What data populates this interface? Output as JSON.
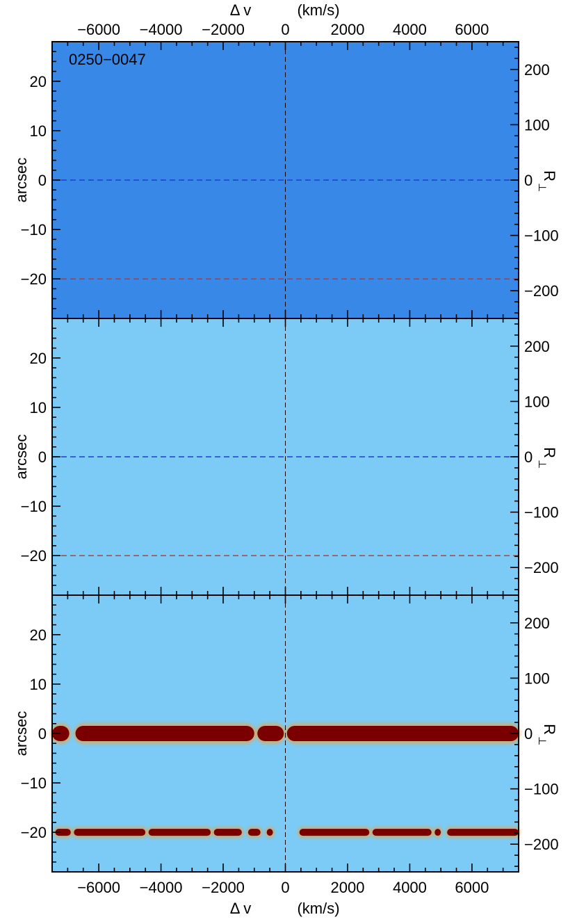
{
  "chart_data": {
    "type": "heatmap",
    "shared": {
      "xlim": [
        -7500,
        7500
      ],
      "ylim": [
        -28,
        28
      ],
      "right_ylim": [
        -250,
        250
      ],
      "x_ticks": [
        -6000,
        -4000,
        -2000,
        0,
        2000,
        4000,
        6000
      ],
      "x_tick_labels": [
        "−6000",
        "−4000",
        "−2000",
        "0",
        "2000",
        "4000",
        "6000"
      ],
      "y_ticks": [
        20,
        10,
        0,
        -10,
        -20
      ],
      "y_tick_labels": [
        "20",
        "10",
        "0",
        "−10",
        "−20"
      ],
      "right_ticks": [
        200,
        100,
        0,
        -100,
        -200
      ],
      "right_tick_labels": [
        "200",
        "100",
        "0",
        "−100",
        "−200"
      ],
      "top_xlabel_main": "Δ v",
      "top_xlabel_unit": "(km/s)",
      "bottom_xlabel_main": "Δ v",
      "bottom_xlabel_unit": "(km/s)",
      "ylabel": "arcsec",
      "right_ylabel_main": "R",
      "right_ylabel_sub": "⊥",
      "colormap": [
        "#0a3fcf",
        "#2a8cf0",
        "#5fd2ee",
        "#aee9c2",
        "#e8f45a",
        "#ffb51e",
        "#f0481a",
        "#7a0000"
      ],
      "vertical_marker_x": 0,
      "blue_dash_y": 0,
      "red_dash_y": -20
    },
    "panels": [
      {
        "label": "0250−0047",
        "texture": "smooth",
        "guide_lines": [
          "blue",
          "red"
        ]
      },
      {
        "label": "",
        "texture": "pixel-noise",
        "guide_lines": [
          "blue",
          "red"
        ]
      },
      {
        "label": "",
        "texture": "pixel-noise-with-bands",
        "guide_lines": [],
        "bands": [
          {
            "y": 0,
            "segments": [
              [
                -7500,
                -6950
              ],
              [
                -6750,
                -1000
              ],
              [
                -900,
                -50
              ],
              [
                50,
                7500
              ]
            ]
          },
          {
            "y": -20,
            "segments": [
              [
                -7400,
                -6900
              ],
              [
                -6800,
                -4500
              ],
              [
                -4400,
                -2400
              ],
              [
                -2300,
                -1400
              ],
              [
                -1200,
                -800
              ],
              [
                -600,
                -400
              ],
              [
                450,
                2700
              ],
              [
                2800,
                4700
              ],
              [
                4800,
                5000
              ],
              [
                5200,
                7500
              ]
            ]
          }
        ]
      }
    ]
  }
}
